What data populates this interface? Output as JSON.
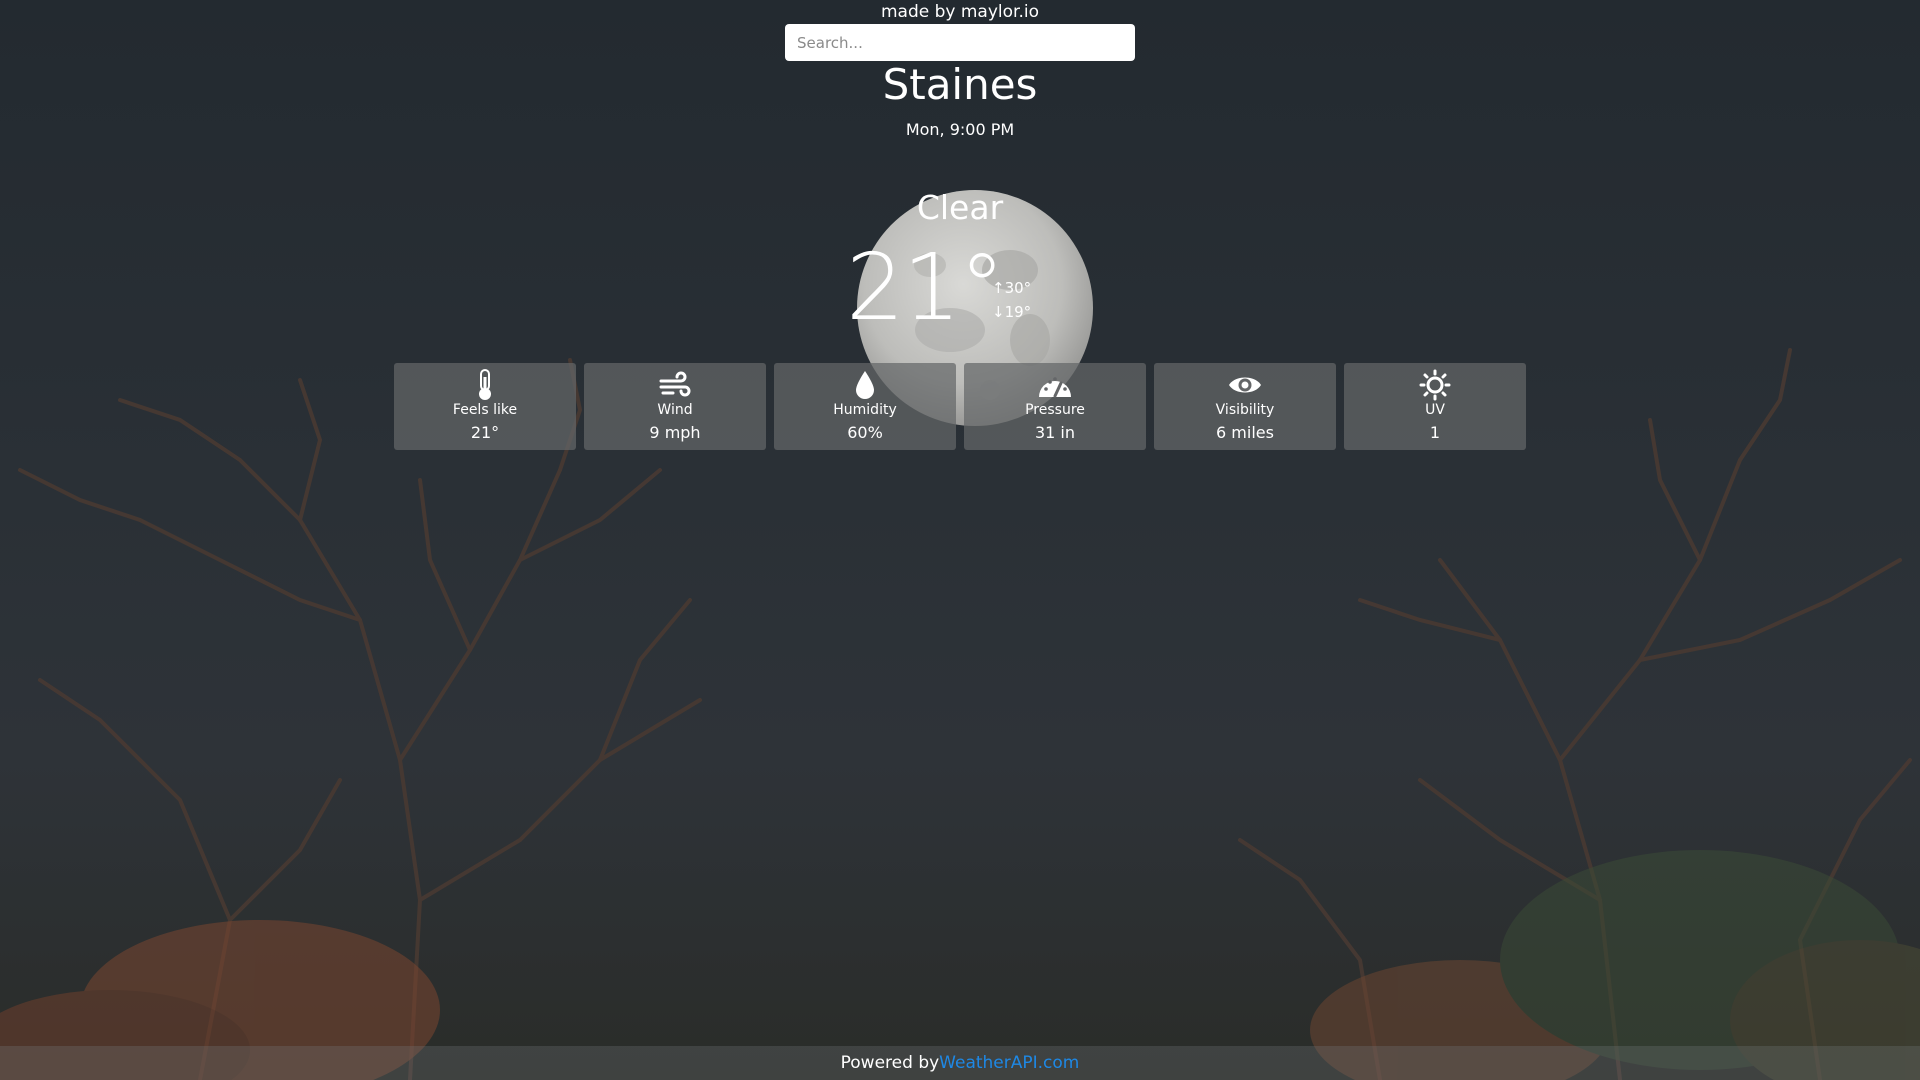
{
  "header": {
    "credit": "made by maylor.io"
  },
  "search": {
    "placeholder": "Search..."
  },
  "location": {
    "city": "Staines",
    "datetime": "Mon, 9:00 PM"
  },
  "current": {
    "condition": "Clear",
    "temperature": "21°",
    "high": "↑30°",
    "low": "↓19°"
  },
  "stats": [
    {
      "icon": "thermometer-icon",
      "label": "Feels like",
      "value": "21°"
    },
    {
      "icon": "wind-icon",
      "label": "Wind",
      "value": "9 mph"
    },
    {
      "icon": "droplet-icon",
      "label": "Humidity",
      "value": "60%"
    },
    {
      "icon": "gauge-icon",
      "label": "Pressure",
      "value": "31 in"
    },
    {
      "icon": "eye-icon",
      "label": "Visibility",
      "value": "6 miles"
    },
    {
      "icon": "sun-icon",
      "label": "UV",
      "value": "1"
    }
  ],
  "footer": {
    "prefix": "Powered by",
    "link_text": "WeatherAPI.com"
  },
  "colors": {
    "link": "#1e88e5",
    "card_bg": "#646668"
  }
}
